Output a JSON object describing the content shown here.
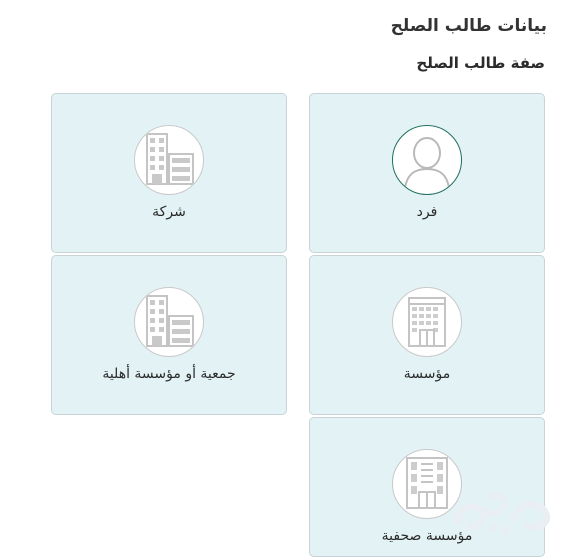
{
  "page": {
    "title": "بيانات طالب الصلح",
    "subtitle": "صفة طالب الصلح"
  },
  "cards": [
    {
      "label": "فرد",
      "icon": "person-icon",
      "selected": true
    },
    {
      "label": "شركة",
      "icon": "building-icon",
      "selected": false
    },
    {
      "label": "مؤسسة",
      "icon": "office-building-icon",
      "selected": false
    },
    {
      "label": "جمعية أو مؤسسة أهلية",
      "icon": "building-icon",
      "selected": false
    },
    {
      "label": "مؤسسة صحفية",
      "icon": "press-building-icon",
      "selected": false
    }
  ],
  "colors": {
    "card_bg": "#e3f3f5",
    "selected_ring": "#1f6f5a"
  }
}
